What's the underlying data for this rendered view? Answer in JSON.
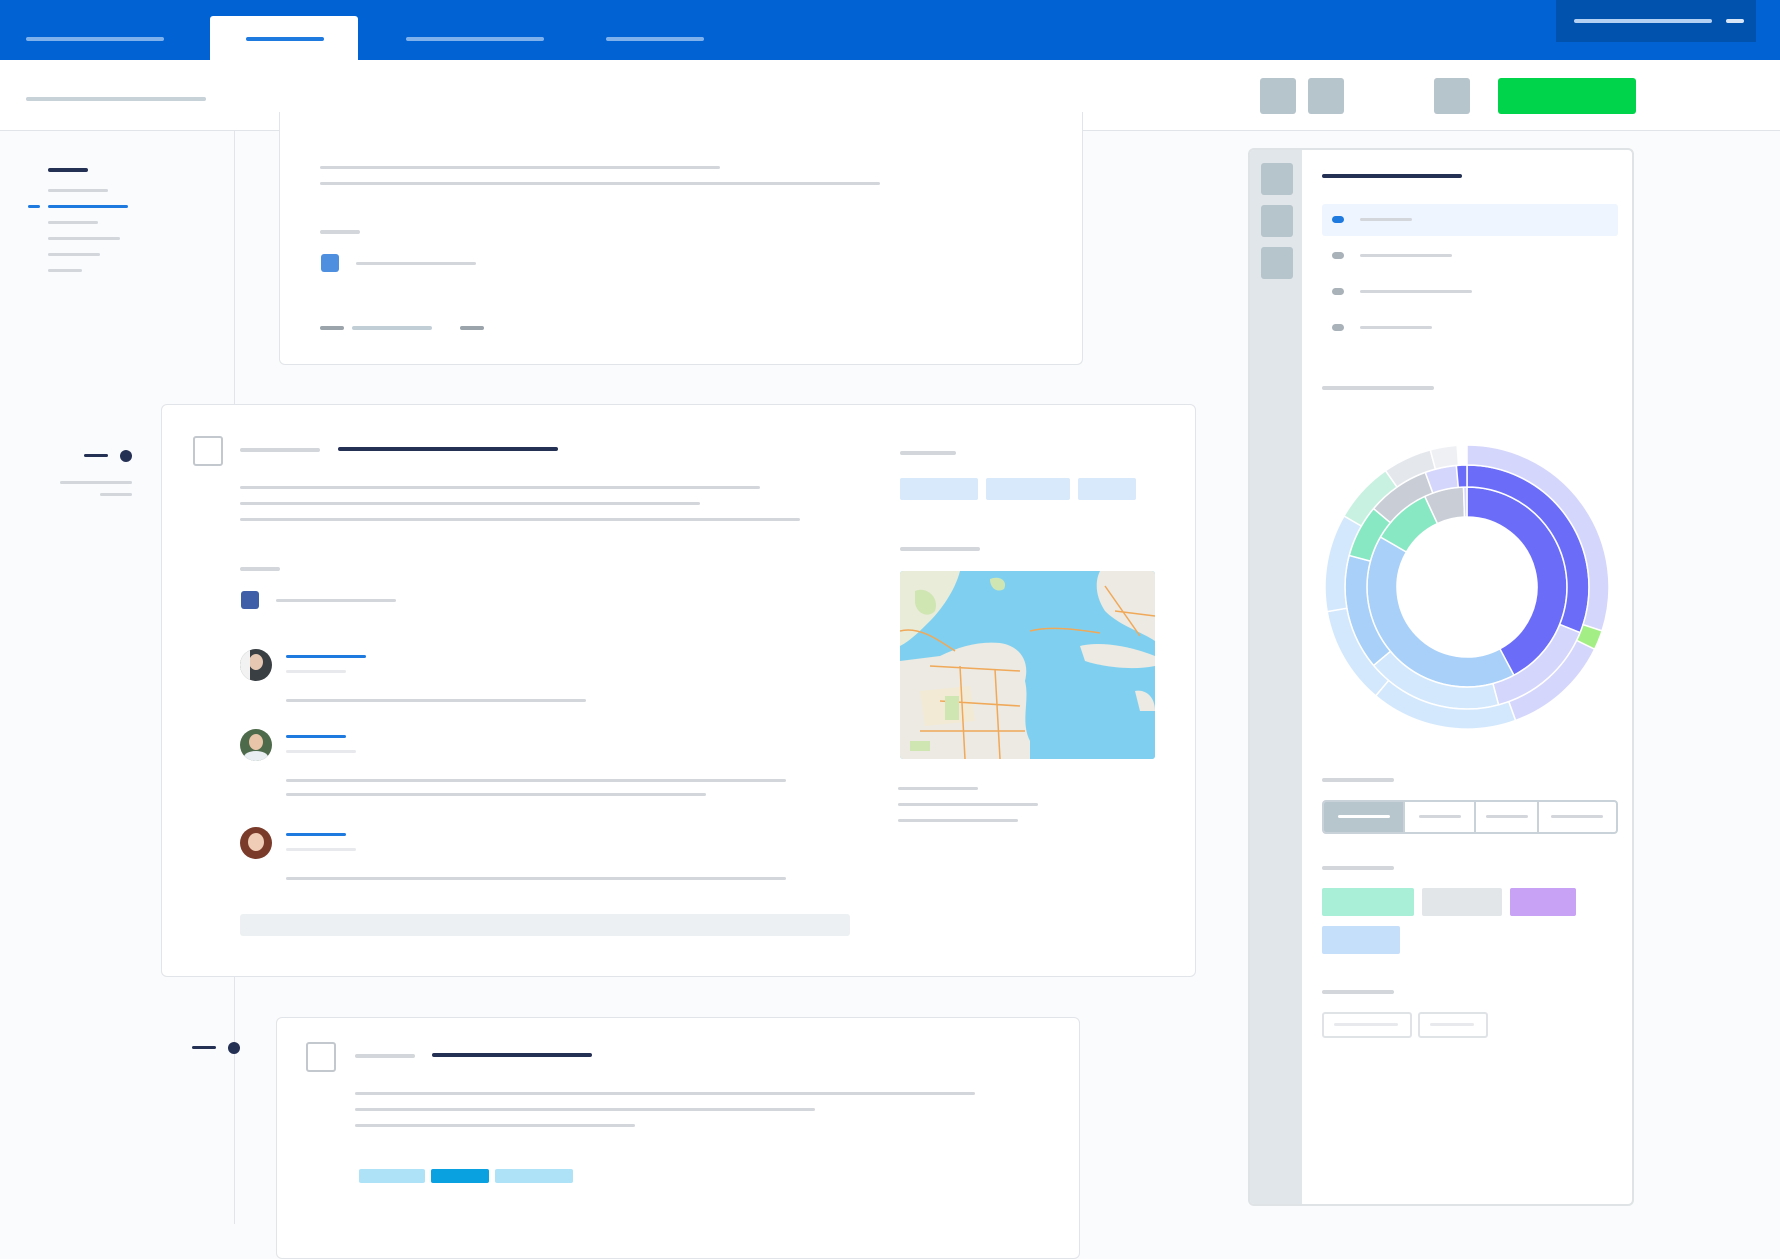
{
  "app": {
    "brand_color": "#0062d3",
    "accent": "#00d44a"
  },
  "top_nav": {
    "tabs": [
      {
        "id": "tab-1",
        "active": false
      },
      {
        "id": "tab-2",
        "active": true
      },
      {
        "id": "tab-3",
        "active": false
      },
      {
        "id": "tab-4",
        "active": false
      }
    ],
    "account_menu": {
      "icon": "menu-dash-icon"
    }
  },
  "toolbar": {
    "buttons": [
      {
        "icon": "toolbar-icon-1"
      },
      {
        "icon": "toolbar-icon-2"
      },
      {
        "icon": "toolbar-icon-3"
      }
    ],
    "primary_color": "#00d44a"
  },
  "sidebar_nav": {
    "items": [
      "section",
      "item-1",
      "item-2-active",
      "item-3",
      "item-4",
      "item-5",
      "item-6"
    ]
  },
  "feed": {
    "cards": [
      {
        "id": "card-top",
        "tag_color": "#4f8fe0"
      },
      {
        "id": "card-main",
        "tag_color": "#3f5fa8",
        "comments": [
          {
            "avatar": "avatar-1"
          },
          {
            "avatar": "avatar-2"
          },
          {
            "avatar": "avatar-3"
          }
        ],
        "labels_colors": [
          "#d7e9fb",
          "#d7e9fb",
          "#d7e9fb"
        ],
        "map": {
          "icon": "map-thumbnail"
        }
      },
      {
        "id": "card-bottom",
        "labels_colors": [
          "#aee3f7",
          "#0aa1e0",
          "#aee3f7"
        ]
      }
    ]
  },
  "right_panel": {
    "tool_icons": [
      "panel-tool-1",
      "panel-tool-2",
      "panel-tool-3"
    ],
    "list": [
      {
        "active": true,
        "dot": "#1f7ae0"
      },
      {
        "active": false,
        "dot": "#a9b1b9"
      },
      {
        "active": false,
        "dot": "#a9b1b9"
      },
      {
        "active": false,
        "dot": "#a9b1b9"
      }
    ],
    "chart_colors": {
      "primary": "#6b6cf7",
      "primary_light": "#d5d6fb",
      "blue": "#a8d0f8",
      "blue_light": "#d3e8fc",
      "green": "#88e8c4",
      "gray": "#c9ced6",
      "lime": "#a3ef86"
    },
    "segmented": {
      "selected_index": 0,
      "count": 4
    },
    "chips": [
      {
        "color": "#a9efd7"
      },
      {
        "color": "#e3e6e9"
      },
      {
        "color": "#c8a2f4"
      },
      {
        "color": "#c5dffa"
      }
    ],
    "outline_buttons": 2
  }
}
